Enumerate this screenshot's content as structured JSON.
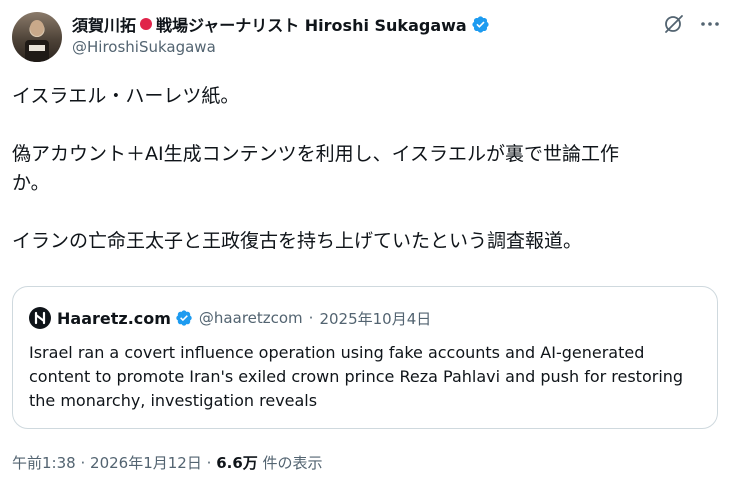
{
  "author": {
    "name_jp": "須賀川拓",
    "name_role": "戦場ジャーナリスト Hiroshi Sukagawa",
    "handle": "@HiroshiSukagawa"
  },
  "tweet": {
    "line1": "イスラエル・ハーレツ紙。",
    "line2": "偽アカウント＋AI生成コンテンツを利用し、イスラエルが裏で世論工作",
    "line3": "か。",
    "line4": "イランの亡命王太子と王政復古を持ち上げていたという調査報道。"
  },
  "quote": {
    "name": "Haaretz.com",
    "handle": "@haaretzcom",
    "separator": "·",
    "date": "2025年10月4日",
    "text": "Israel ran a covert influence operation using fake accounts and AI-generated content to promote Iran's exiled crown prince Reza Pahlavi and push for restoring the monarchy, investigation reveals"
  },
  "footer": {
    "time": "午前1:38",
    "date": "2026年1月12日",
    "views_count": "6.6万",
    "views_label": "件の表示",
    "separator": "·"
  },
  "colors": {
    "verified_blue": "#1d9bf0",
    "secondary_text": "#536471",
    "border": "#cfd9de"
  },
  "icons": [
    "grok-icon",
    "more-icon",
    "verified-badge-icon",
    "japan-flag-icon",
    "haaretz-logo-icon"
  ]
}
